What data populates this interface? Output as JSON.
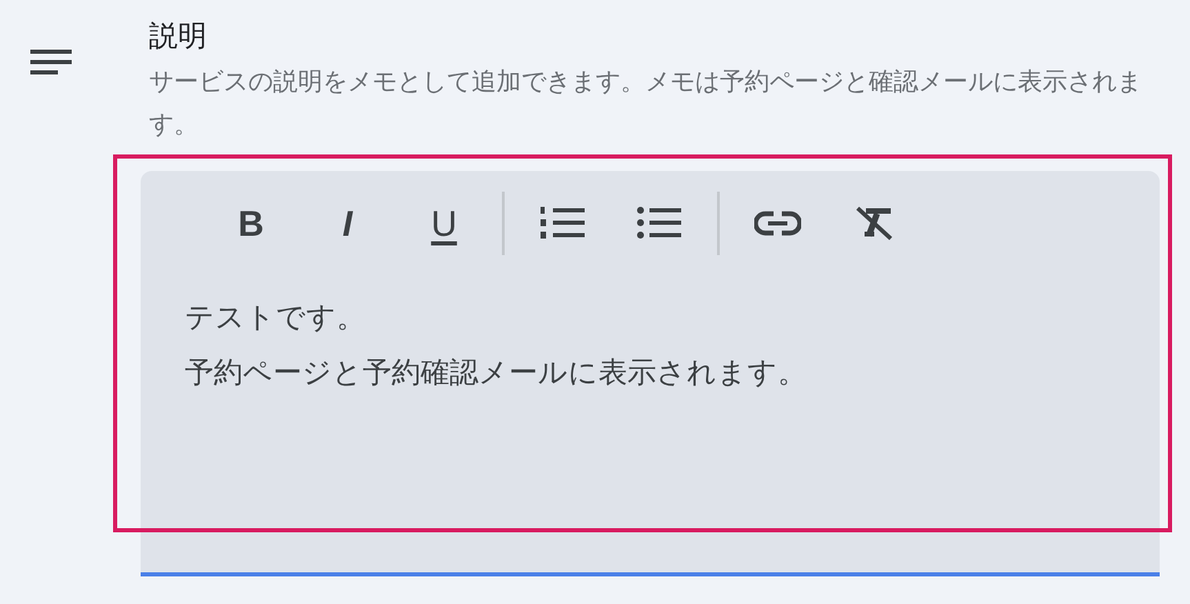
{
  "section": {
    "title": "説明",
    "description": "サービスの説明をメモとして追加できます。メモは予約ページと確認メールに表示されます。"
  },
  "toolbar": [
    {
      "kind": "bold",
      "label": "B"
    },
    {
      "kind": "italic",
      "label": "I"
    },
    {
      "kind": "underline",
      "label": "U"
    },
    {
      "kind": "separator"
    },
    {
      "kind": "numbered-list"
    },
    {
      "kind": "bulleted-list"
    },
    {
      "kind": "separator"
    },
    {
      "kind": "link"
    },
    {
      "kind": "clear-format"
    }
  ],
  "editor": {
    "lines": [
      "テストです。",
      "予約ページと予約確認メールに表示されます。"
    ],
    "focused": true
  },
  "highlight": true
}
